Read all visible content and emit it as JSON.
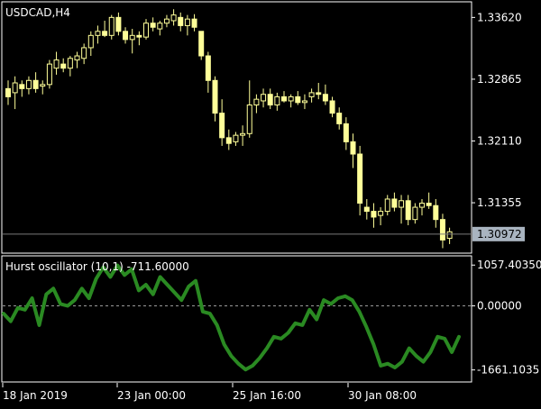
{
  "window": {
    "title": "USDCAD,H4"
  },
  "colors": {
    "background": "#000000",
    "frame": "#ffffff",
    "candle": "#ffff99",
    "bid_line": "#7a7a7a",
    "price_tag_bg": "#a9b4c0",
    "oscillator": "#2a8a22",
    "zero_level": "#9a9a9a"
  },
  "price_axis": {
    "ticks": [
      "1.33620",
      "1.32865",
      "1.32110",
      "1.31355"
    ],
    "current_price": "1.30972"
  },
  "indicator": {
    "title": "Hurst oscillator (10,1) -711.60000",
    "ticks": [
      "1057.40350",
      "0.00000",
      "-1661.1035"
    ]
  },
  "time_axis": {
    "labels": [
      "18 Jan 2019",
      "23 Jan 00:00",
      "25 Jan 16:00",
      "30 Jan 08:00"
    ]
  },
  "chart_data": [
    {
      "type": "candlestick",
      "title": "USDCAD,H4",
      "ylim": [
        1.3075,
        1.338
      ],
      "candles": [
        [
          1.3275,
          1.3285,
          1.3255,
          1.3265
        ],
        [
          1.327,
          1.329,
          1.325,
          1.3282
        ],
        [
          1.328,
          1.3285,
          1.3265,
          1.3275
        ],
        [
          1.3275,
          1.329,
          1.3268,
          1.3285
        ],
        [
          1.3285,
          1.3295,
          1.327,
          1.3275
        ],
        [
          1.3278,
          1.3285,
          1.3268,
          1.328
        ],
        [
          1.328,
          1.331,
          1.3275,
          1.3305
        ],
        [
          1.33,
          1.332,
          1.3292,
          1.331
        ],
        [
          1.3305,
          1.3312,
          1.3295,
          1.33
        ],
        [
          1.33,
          1.3315,
          1.329,
          1.3312
        ],
        [
          1.331,
          1.332,
          1.33,
          1.3315
        ],
        [
          1.3312,
          1.333,
          1.3305,
          1.3325
        ],
        [
          1.3325,
          1.3345,
          1.3315,
          1.334
        ],
        [
          1.334,
          1.3352,
          1.333,
          1.3345
        ],
        [
          1.3345,
          1.3358,
          1.3338,
          1.334
        ],
        [
          1.334,
          1.3365,
          1.3335,
          1.3362
        ],
        [
          1.3362,
          1.3368,
          1.334,
          1.3345
        ],
        [
          1.3345,
          1.335,
          1.333,
          1.3335
        ],
        [
          1.3335,
          1.3348,
          1.3318,
          1.334
        ],
        [
          1.334,
          1.3345,
          1.3328,
          1.3338
        ],
        [
          1.3338,
          1.336,
          1.3335,
          1.3355
        ],
        [
          1.3355,
          1.3362,
          1.3345,
          1.335
        ],
        [
          1.3348,
          1.3358,
          1.334,
          1.3355
        ],
        [
          1.3355,
          1.3365,
          1.335,
          1.336
        ],
        [
          1.3358,
          1.3372,
          1.3352,
          1.3365
        ],
        [
          1.3362,
          1.3368,
          1.3345,
          1.3352
        ],
        [
          1.3352,
          1.3365,
          1.334,
          1.336
        ],
        [
          1.336,
          1.3366,
          1.3345,
          1.335
        ],
        [
          1.3345,
          1.333,
          1.331,
          1.3315
        ],
        [
          1.3315,
          1.332,
          1.327,
          1.3285
        ],
        [
          1.3285,
          1.329,
          1.3235,
          1.3245
        ],
        [
          1.3245,
          1.3262,
          1.3205,
          1.3215
        ],
        [
          1.3215,
          1.3225,
          1.32,
          1.3208
        ],
        [
          1.321,
          1.3222,
          1.3205,
          1.3218
        ],
        [
          1.3218,
          1.323,
          1.3205,
          1.322
        ],
        [
          1.322,
          1.3285,
          1.3215,
          1.3255
        ],
        [
          1.3255,
          1.3268,
          1.3245,
          1.3262
        ],
        [
          1.326,
          1.3275,
          1.3252,
          1.3268
        ],
        [
          1.3268,
          1.3275,
          1.325,
          1.3255
        ],
        [
          1.3255,
          1.327,
          1.3248,
          1.3265
        ],
        [
          1.3265,
          1.3272,
          1.3258,
          1.326
        ],
        [
          1.326,
          1.3268,
          1.3252,
          1.3265
        ],
        [
          1.3265,
          1.3272,
          1.3255,
          1.3258
        ],
        [
          1.3258,
          1.3268,
          1.325,
          1.326
        ],
        [
          1.3265,
          1.3275,
          1.3258,
          1.327
        ],
        [
          1.327,
          1.3282,
          1.3262,
          1.3268
        ],
        [
          1.3268,
          1.328,
          1.3255,
          1.326
        ],
        [
          1.326,
          1.3265,
          1.324,
          1.3245
        ],
        [
          1.3245,
          1.3252,
          1.3225,
          1.3232
        ],
        [
          1.3232,
          1.324,
          1.32,
          1.321
        ],
        [
          1.321,
          1.322,
          1.3178,
          1.3195
        ],
        [
          1.3195,
          1.3205,
          1.312,
          1.3135
        ],
        [
          1.313,
          1.314,
          1.3115,
          1.3125
        ],
        [
          1.3125,
          1.3135,
          1.3105,
          1.3118
        ],
        [
          1.312,
          1.313,
          1.3108,
          1.3125
        ],
        [
          1.3125,
          1.3145,
          1.312,
          1.314
        ],
        [
          1.314,
          1.3148,
          1.3125,
          1.313
        ],
        [
          1.313,
          1.3145,
          1.311,
          1.3138
        ],
        [
          1.3138,
          1.3145,
          1.3108,
          1.3115
        ],
        [
          1.3115,
          1.3135,
          1.311,
          1.313
        ],
        [
          1.313,
          1.314,
          1.312,
          1.3135
        ],
        [
          1.3135,
          1.3148,
          1.3128,
          1.3132
        ],
        [
          1.3132,
          1.314,
          1.3105,
          1.3115
        ],
        [
          1.3115,
          1.3122,
          1.308,
          1.309
        ],
        [
          1.3092,
          1.3105,
          1.3085,
          1.31
        ]
      ]
    },
    {
      "type": "line",
      "title": "Hurst oscillator (10,1) -711.60000",
      "ylim": [
        -1950,
        1250
      ],
      "series": [
        {
          "values": [
            -200,
            -400,
            -50,
            -100,
            200,
            -500,
            300,
            450,
            50,
            0,
            150,
            450,
            200,
            700,
            1000,
            750,
            1050,
            800,
            950,
            400,
            550,
            300,
            750,
            550,
            350,
            150,
            500,
            650,
            -150,
            -200,
            -500,
            -1000,
            -1300,
            -1500,
            -1650,
            -1550,
            -1350,
            -1100,
            -800,
            -850,
            -700,
            -450,
            -500,
            -100,
            -350,
            150,
            50,
            200,
            250,
            150,
            -150,
            -550,
            -1000,
            -1550,
            -1500,
            -1600,
            -1450,
            -1100,
            -1300,
            -1450,
            -1200,
            -800,
            -850,
            -1200,
            -800
          ]
        }
      ]
    }
  ]
}
